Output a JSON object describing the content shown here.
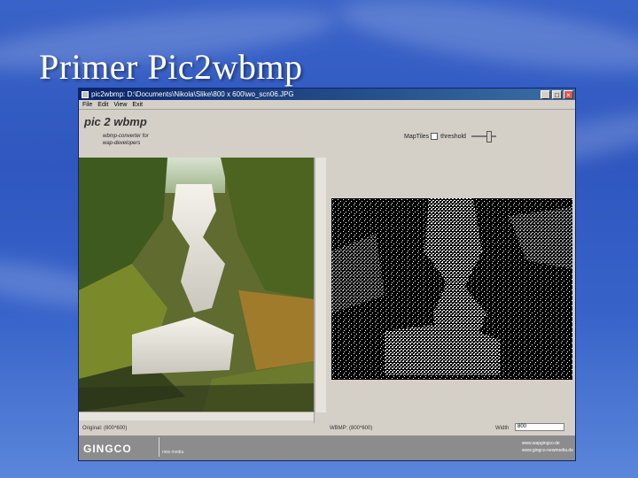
{
  "slide": {
    "title": "Primer Pic2wbmp"
  },
  "window": {
    "title": "pic2wbmp: D:\\Documents\\Nikola\\Slike\\800 x 600\\wo_scn06.JPG",
    "buttons": {
      "minimize": "_",
      "maximize": "□",
      "close": "×"
    }
  },
  "menu": [
    "File",
    "Edit",
    "View",
    "Exit"
  ],
  "app_header": {
    "logo": "pic 2 wbmp",
    "subtitle": "wbmp-converter for\nwap-developers",
    "threshold_checkbox_label": "MapTiles",
    "threshold_label": "threshold"
  },
  "status": {
    "original": "Original: (800*600)",
    "wbmp": "WBMP: (800*600)",
    "width_label": "Width",
    "width_value": "800"
  },
  "footer": {
    "brand": "GINGCO",
    "tagline": "new media",
    "links": "www.wapgingco.de\nwww.gingco-newmedia.de"
  },
  "colors": {
    "background": "#3a63c8",
    "titlebar": "#0a246a",
    "footer": "#8c8c8c"
  }
}
